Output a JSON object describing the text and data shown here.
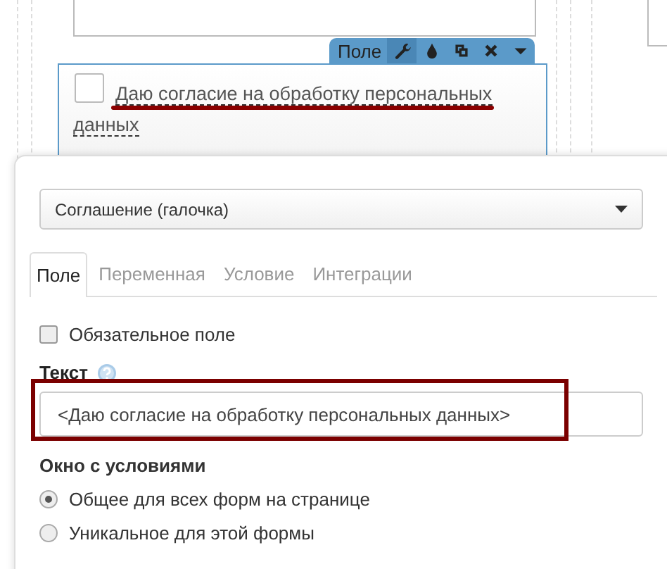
{
  "field": {
    "toolbar": {
      "label": "Поле",
      "tools": [
        {
          "kind": "wrench",
          "selected": true
        },
        {
          "kind": "drop",
          "selected": false
        },
        {
          "kind": "copy",
          "selected": false
        },
        {
          "kind": "close",
          "selected": false
        },
        {
          "kind": "caret",
          "selected": false
        }
      ]
    },
    "checked": false,
    "label": "Даю согласие на обработку персональных данных"
  },
  "settings": {
    "type_select": {
      "value": "Соглашение (галочка)"
    },
    "tabs": [
      {
        "label": "Поле",
        "selected": true
      },
      {
        "label": "Переменная",
        "selected": false
      },
      {
        "label": "Условие",
        "selected": false
      },
      {
        "label": "Интеграции",
        "selected": false
      }
    ],
    "required": {
      "label": "Обязательное поле",
      "checked": false
    },
    "text": {
      "label": "Текст",
      "value": "<Даю согласие на обработку персональных данных>"
    },
    "terms": {
      "title": "Окно с условиями",
      "options": [
        {
          "label": "Общее для всех форм на странице",
          "selected": true
        },
        {
          "label": "Уникальное для этой формы",
          "selected": false
        }
      ]
    }
  }
}
